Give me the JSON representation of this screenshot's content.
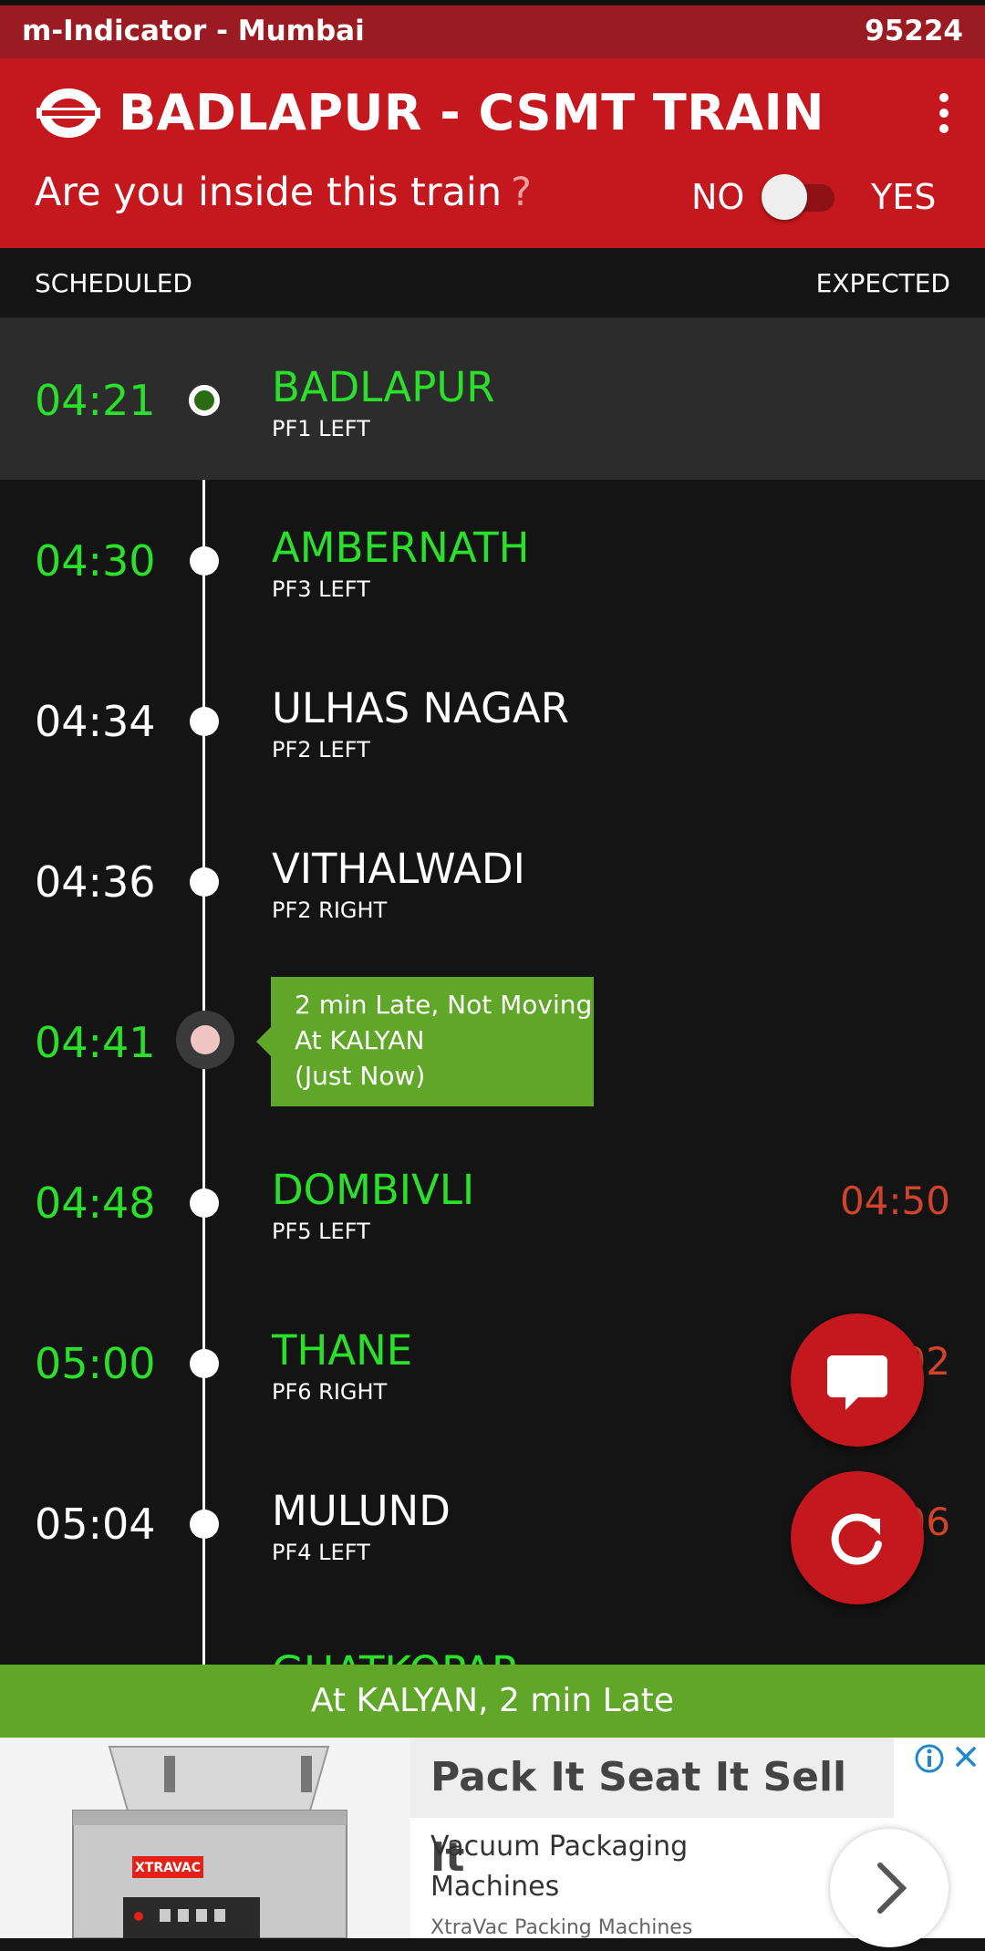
{
  "statusbar": {
    "app_title": "m-Indicator - Mumbai",
    "train_number": "95224"
  },
  "header": {
    "title": "BADLAPUR - CSMT TRAIN",
    "question": "Are you inside this train",
    "question_mark": "?",
    "no_label": "NO",
    "yes_label": "YES",
    "toggle_on": false
  },
  "columns": {
    "scheduled": "SCHEDULED",
    "expected": "EXPECTED"
  },
  "stations": [
    {
      "time": "04:21",
      "name": "BADLAPUR",
      "platform": "PF1 LEFT",
      "expected": "",
      "passed": true
    },
    {
      "time": "04:30",
      "name": "AMBERNATH",
      "platform": "PF3 LEFT",
      "expected": "",
      "passed": true
    },
    {
      "time": "04:34",
      "name": "ULHAS NAGAR",
      "platform": "PF2 LEFT",
      "expected": "",
      "passed": false
    },
    {
      "time": "04:36",
      "name": "VITHALWADI",
      "platform": "PF2 RIGHT",
      "expected": "",
      "passed": false
    },
    {
      "time": "04:48",
      "name": "DOMBIVLI",
      "platform": "PF5 LEFT",
      "expected": "04:50",
      "passed": true
    },
    {
      "time": "05:00",
      "name": "THANE",
      "platform": "PF6 RIGHT",
      "expected": "05:02",
      "passed": true
    },
    {
      "time": "05:04",
      "name": "MULUND",
      "platform": "PF4 LEFT",
      "expected": "05:06",
      "passed": false
    },
    {
      "time": "",
      "name": "GHATKOPAR",
      "platform": "",
      "expected": "",
      "passed": true
    }
  ],
  "current_position": {
    "time": "04:41",
    "line1": "2 min Late, Not Moving",
    "line2": "At KALYAN",
    "line3": "(Just Now)"
  },
  "status_bar": {
    "text": "At KALYAN, 2 min Late"
  },
  "ad": {
    "title": "Pack It Seat It Sell It",
    "line1": "Vacuum Packaging",
    "line2": "Machines",
    "advertiser": "XtraVac Packing Machines",
    "product_brand": "XTRAVAC"
  },
  "colors": {
    "header_red": "#c4171e",
    "green_text": "#2ae02a",
    "late_red": "#d2432c",
    "banner_green": "#5fa629"
  }
}
